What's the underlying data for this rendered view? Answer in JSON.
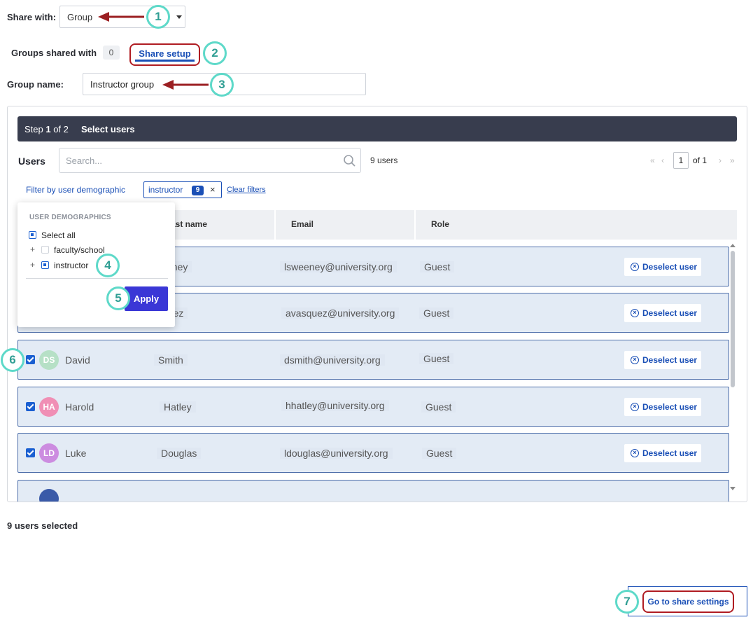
{
  "share_with": {
    "label": "Share with:",
    "value": "Group"
  },
  "tabs": {
    "groups_label": "Groups shared with",
    "groups_count": "0",
    "share_setup": "Share setup"
  },
  "group_name": {
    "label": "Group name:",
    "value": "Instructor group"
  },
  "step": {
    "prefix": "Step ",
    "current": "1",
    "suffix": " of 2",
    "title": "Select users"
  },
  "users": {
    "title": "Users",
    "search_placeholder": "Search...",
    "count_num": "9",
    "count_word": " users",
    "pager": {
      "first": "«",
      "prev": "‹",
      "page": "1",
      "of": "of 1",
      "next": "›",
      "last": "»"
    }
  },
  "filter": {
    "link": "Filter by user demographic",
    "chip_label": "instructor",
    "chip_count": "9",
    "chip_remove": "×",
    "clear": "Clear filters"
  },
  "table_headers": {
    "last_name": "Last name",
    "last_name_visible": "ast name",
    "email": "Email",
    "role": "Role"
  },
  "rows": [
    {
      "initials": "",
      "first": "",
      "last": "eney",
      "email": "lsweeney@university.org",
      "role": "Guest",
      "avatar_color": "#9db3d8"
    },
    {
      "initials": "",
      "first": "",
      "last": "quez",
      "email": "avasquez@university.org",
      "role": "Guest",
      "avatar_color": "#9db3d8"
    },
    {
      "initials": "DS",
      "first": "David",
      "last": "Smith",
      "email": "dsmith@university.org",
      "role": "Guest",
      "avatar_color": "#b6e0c6"
    },
    {
      "initials": "HA",
      "first": "Harold",
      "last": "Hatley",
      "email": "hhatley@university.org",
      "role": "Guest",
      "avatar_color": "#f08fb5"
    },
    {
      "initials": "LD",
      "first": "Luke",
      "last": "Douglas",
      "email": "ldouglas@university.org",
      "role": "Guest",
      "avatar_color": "#cc8ce0"
    }
  ],
  "row_action": "Deselect user",
  "demographics": {
    "header": "USER DEMOGRAPHICS",
    "select_all": "Select all",
    "options": [
      "faculty/school",
      "instructor"
    ],
    "expand": "+",
    "apply": "Apply"
  },
  "selected_count": "9 users selected",
  "go_button": "Go to share settings",
  "markers": [
    "1",
    "2",
    "3",
    "4",
    "5",
    "6",
    "7"
  ],
  "colors": {
    "accent": "#1a4fb6",
    "annotation_red": "#b01c22",
    "annotation_teal": "#5ed9c9",
    "apply": "#3a37d6",
    "stepbar": "#383d4e"
  }
}
